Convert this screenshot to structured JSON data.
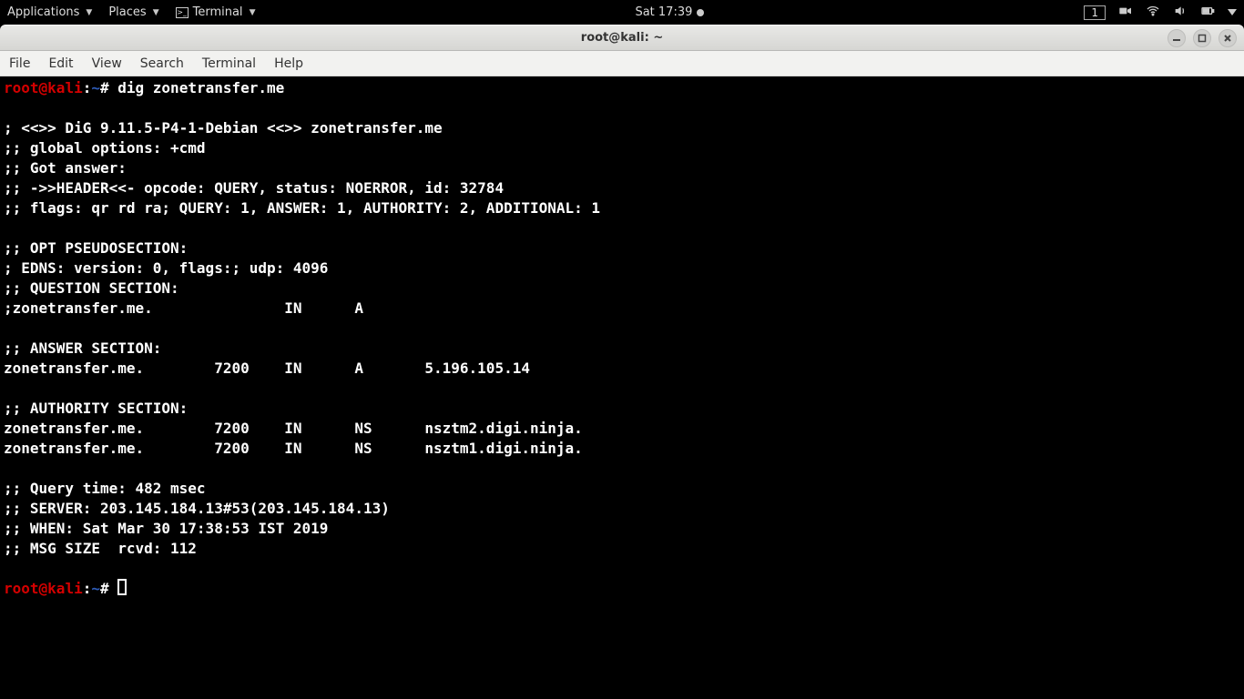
{
  "topbar": {
    "applications": "Applications",
    "places": "Places",
    "terminal": "Terminal",
    "clock": "Sat 17:39",
    "workspace": "1"
  },
  "window": {
    "title": "root@kali: ~"
  },
  "menubar": {
    "file": "File",
    "edit": "Edit",
    "view": "View",
    "search": "Search",
    "terminal": "Terminal",
    "help": "Help"
  },
  "prompt": {
    "user": "root",
    "at": "@",
    "host": "kali",
    "colon": ":",
    "path": "~",
    "hash": "#"
  },
  "term": {
    "cmd1": " dig zonetransfer.me",
    "blank": "",
    "l1": "; <<>> DiG 9.11.5-P4-1-Debian <<>> zonetransfer.me",
    "l2": ";; global options: +cmd",
    "l3": ";; Got answer:",
    "l4": ";; ->>HEADER<<- opcode: QUERY, status: NOERROR, id: 32784",
    "l5": ";; flags: qr rd ra; QUERY: 1, ANSWER: 1, AUTHORITY: 2, ADDITIONAL: 1",
    "l6": ";; OPT PSEUDOSECTION:",
    "l7": "; EDNS: version: 0, flags:; udp: 4096",
    "l8": ";; QUESTION SECTION:",
    "l9": ";zonetransfer.me.               IN      A",
    "l10": ";; ANSWER SECTION:",
    "l11": "zonetransfer.me.        7200    IN      A       5.196.105.14",
    "l12": ";; AUTHORITY SECTION:",
    "l13": "zonetransfer.me.        7200    IN      NS      nsztm2.digi.ninja.",
    "l14": "zonetransfer.me.        7200    IN      NS      nsztm1.digi.ninja.",
    "l15": ";; Query time: 482 msec",
    "l16": ";; SERVER: 203.145.184.13#53(203.145.184.13)",
    "l17": ";; WHEN: Sat Mar 30 17:38:53 IST 2019",
    "l18": ";; MSG SIZE  rcvd: 112"
  }
}
